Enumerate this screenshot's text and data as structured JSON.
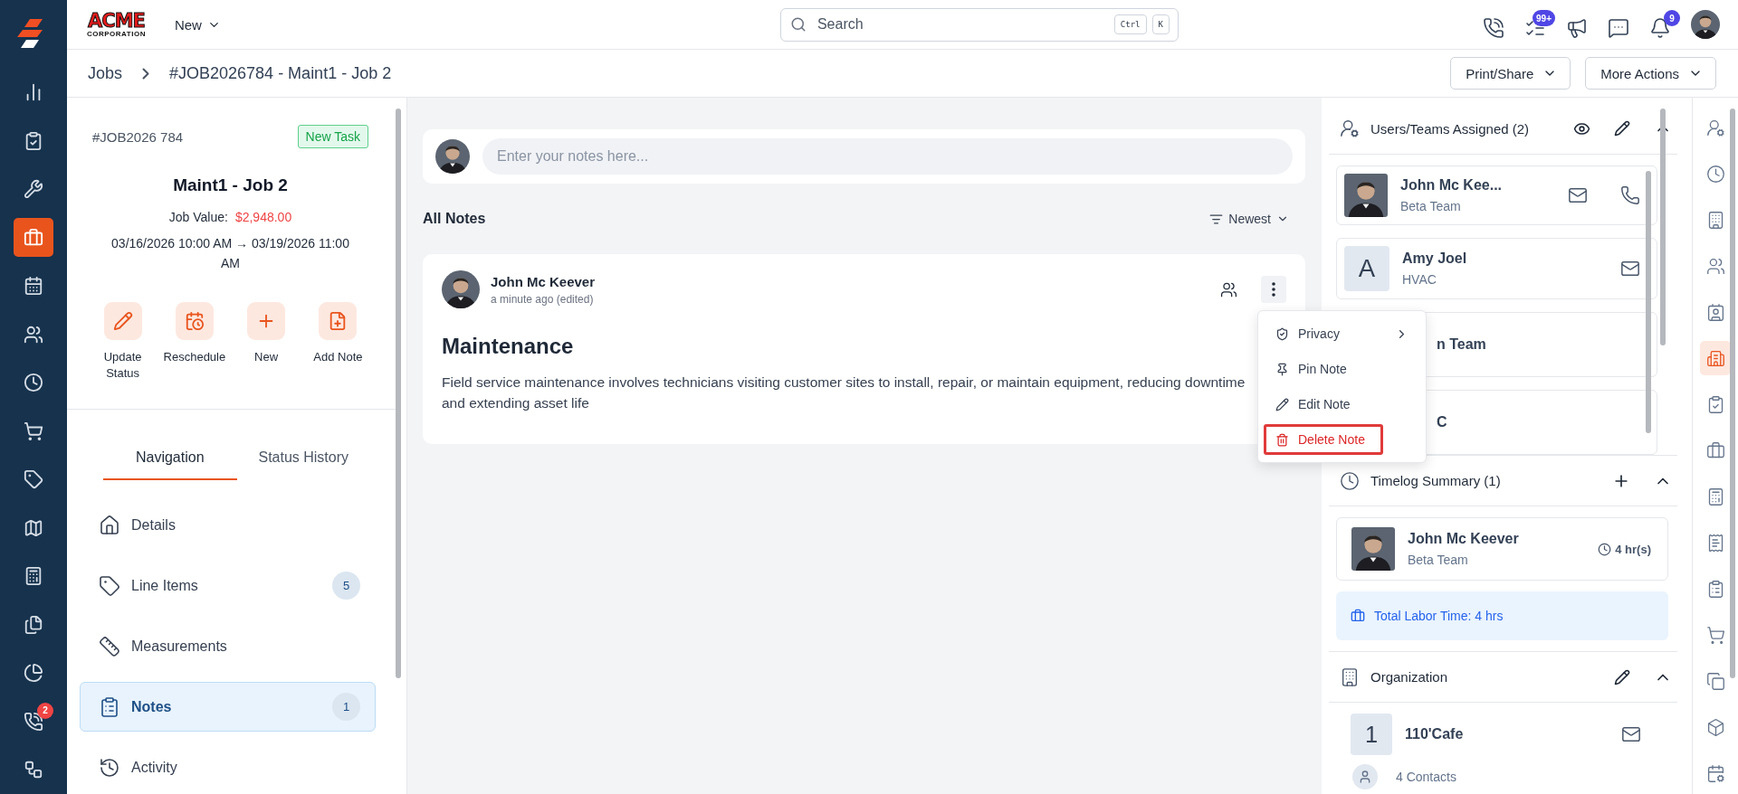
{
  "logo": {
    "word": "ACME",
    "tagline": "CORPORATION"
  },
  "sidebar": {
    "items": [
      {
        "selected": false
      },
      {
        "selected": false
      },
      {
        "selected": false
      },
      {
        "selected": true
      },
      {
        "selected": false
      },
      {
        "selected": false
      },
      {
        "selected": false
      },
      {
        "selected": false
      },
      {
        "selected": false
      },
      {
        "selected": false
      },
      {
        "selected": false
      },
      {
        "selected": false
      },
      {
        "selected": false
      },
      {
        "selected": false,
        "badge": "2"
      },
      {
        "selected": false
      }
    ]
  },
  "topbar": {
    "new_menu": "New",
    "search": {
      "placeholder": "Search",
      "shortcut": [
        "Ctrl",
        "K"
      ]
    },
    "icons": [
      {
        "kind": "phone"
      },
      {
        "kind": "tasks",
        "badge": "99+"
      },
      {
        "kind": "megaphone"
      },
      {
        "kind": "chat"
      },
      {
        "kind": "bell",
        "badge": "9"
      }
    ]
  },
  "breadcrumb": [
    "Jobs",
    "#JOB2026784 - Maint1 - Job 2"
  ],
  "actions": [
    "Print/Share",
    "More Actions"
  ],
  "job": {
    "number": "#JOB2026 784",
    "status": "New Task",
    "title": "Maint1 - Job 2",
    "value_label": "Job Value:",
    "value": "$2,948.00",
    "dates": "03/16/2026 10:00 AM → 03/19/2026 11:00 AM",
    "quick_actions": [
      "Update Status",
      "Reschedule",
      "New",
      "Add Note"
    ]
  },
  "tabs": [
    {
      "label": "Navigation",
      "selected": true
    },
    {
      "label": "Status History",
      "selected": false
    }
  ],
  "nav": [
    {
      "label": "Details",
      "selected": false
    },
    {
      "label": "Line Items",
      "count": "5",
      "selected": false
    },
    {
      "label": "Measurements",
      "selected": false
    },
    {
      "label": "Notes",
      "count": "1",
      "selected": true
    },
    {
      "label": "Activity",
      "selected": false
    }
  ],
  "composer": {
    "placeholder": "Enter your notes here..."
  },
  "notes_header": {
    "title": "All Notes",
    "sort": "Newest"
  },
  "note": {
    "author": "John Mc Keever",
    "time": "a minute ago (edited)",
    "title": "Maintenance",
    "body": "Field service maintenance involves technicians visiting customer sites to install, repair, or maintain equipment, reducing downtime and extending asset life"
  },
  "menu": [
    {
      "label": "Privacy",
      "kind": "submenu",
      "highlighted": false
    },
    {
      "label": "Pin Note",
      "kind": "pin",
      "highlighted": false
    },
    {
      "label": "Edit Note",
      "kind": "edit",
      "highlighted": false
    },
    {
      "label": "Delete Note",
      "kind": "delete",
      "highlighted": true
    }
  ],
  "assigned": {
    "title": "Users/Teams Assigned (2)",
    "members": [
      {
        "name": "John Mc Kee...",
        "team": "Beta Team",
        "kind": "photo",
        "phone": true
      },
      {
        "name": "Amy Joel",
        "team": "HVAC",
        "kind": "initial",
        "initial": "A",
        "phone": false
      },
      {
        "name": "n Team",
        "kind": "covered"
      },
      {
        "name": "C",
        "kind": "covered"
      }
    ]
  },
  "timelog": {
    "title": "Timelog Summary (1)",
    "name": "John Mc Keever",
    "team": "Beta Team",
    "hours": "4 hr(s)",
    "total": "Total Labor Time: 4 hrs"
  },
  "organization": {
    "title": "Organization",
    "initial": "1",
    "name": "110'Cafe",
    "contacts": "4 Contacts"
  },
  "rail": {
    "items": [
      {
        "selected": false
      },
      {
        "selected": false
      },
      {
        "selected": false
      },
      {
        "selected": false
      },
      {
        "selected": false
      },
      {
        "selected": true
      },
      {
        "selected": false
      },
      {
        "selected": false
      },
      {
        "selected": false
      },
      {
        "selected": false
      },
      {
        "selected": false
      },
      {
        "selected": false
      },
      {
        "selected": false
      },
      {
        "selected": false
      },
      {
        "selected": false
      }
    ]
  }
}
